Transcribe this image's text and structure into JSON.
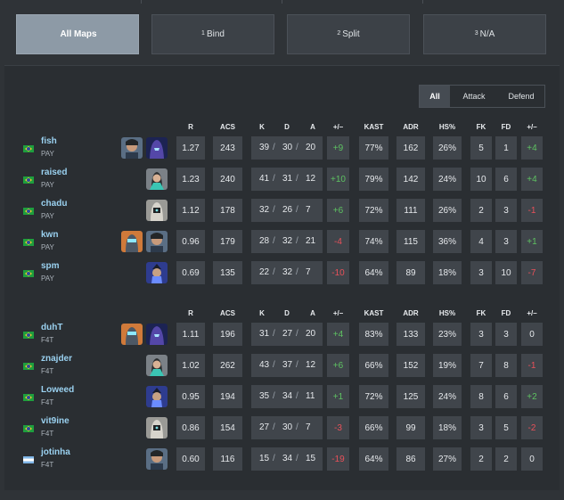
{
  "tabs": [
    {
      "num": "",
      "label": "All Maps",
      "active": true
    },
    {
      "num": "1",
      "label": "Bind",
      "active": false
    },
    {
      "num": "2",
      "label": "Split",
      "active": false
    },
    {
      "num": "3",
      "label": "N/A",
      "active": false
    }
  ],
  "filter": {
    "all": "All",
    "attack": "Attack",
    "defend": "Defend"
  },
  "columns": [
    "R",
    "ACS",
    "K",
    "D",
    "A",
    "+/–",
    "KAST",
    "ADR",
    "HS%",
    "FK",
    "FD",
    "+/–"
  ],
  "kda_separator": "/",
  "colors": {
    "positive": "#5ec262",
    "negative": "#e8515a",
    "accent_name": "#9ad1f0"
  },
  "teams": [
    {
      "players": [
        {
          "name": "fish",
          "team": "PAY",
          "flag": "brazil-flag-icon",
          "agents": [
            "harbor-agent-icon",
            "omen-agent-icon"
          ],
          "r": "1.27",
          "acs": "243",
          "k": "39",
          "d": "30",
          "a": "20",
          "kd_diff": "+9",
          "kast": "77%",
          "adr": "162",
          "hs": "26%",
          "fk": "5",
          "fd": "1",
          "fk_diff": "+4"
        },
        {
          "name": "raised",
          "team": "PAY",
          "flag": "brazil-flag-icon",
          "agents": [
            "sage-agent-icon"
          ],
          "r": "1.23",
          "acs": "240",
          "k": "41",
          "d": "31",
          "a": "12",
          "kd_diff": "+10",
          "kast": "79%",
          "adr": "142",
          "hs": "24%",
          "fk": "10",
          "fd": "6",
          "fk_diff": "+4"
        },
        {
          "name": "chadu",
          "team": "PAY",
          "flag": "brazil-flag-icon",
          "agents": [
            "cypher-agent-icon"
          ],
          "r": "1.12",
          "acs": "178",
          "k": "32",
          "d": "26",
          "a": "7",
          "kd_diff": "+6",
          "kast": "72%",
          "adr": "111",
          "hs": "26%",
          "fk": "2",
          "fd": "3",
          "fk_diff": "-1"
        },
        {
          "name": "kwn",
          "team": "PAY",
          "flag": "brazil-flag-icon",
          "agents": [
            "kayo-agent-icon",
            "harbor-agent-icon"
          ],
          "r": "0.96",
          "acs": "179",
          "k": "28",
          "d": "32",
          "a": "21",
          "kd_diff": "-4",
          "kast": "74%",
          "adr": "115",
          "hs": "36%",
          "fk": "4",
          "fd": "3",
          "fk_diff": "+1"
        },
        {
          "name": "spm",
          "team": "PAY",
          "flag": "brazil-flag-icon",
          "agents": [
            "yoru-agent-icon"
          ],
          "r": "0.69",
          "acs": "135",
          "k": "22",
          "d": "32",
          "a": "7",
          "kd_diff": "-10",
          "kast": "64%",
          "adr": "89",
          "hs": "18%",
          "fk": "3",
          "fd": "10",
          "fk_diff": "-7"
        }
      ]
    },
    {
      "players": [
        {
          "name": "duhT",
          "team": "F4T",
          "flag": "brazil-flag-icon",
          "agents": [
            "kayo-agent-icon",
            "omen-agent-icon"
          ],
          "r": "1.11",
          "acs": "196",
          "k": "31",
          "d": "27",
          "a": "20",
          "kd_diff": "+4",
          "kast": "83%",
          "adr": "133",
          "hs": "23%",
          "fk": "3",
          "fd": "3",
          "fk_diff": "0"
        },
        {
          "name": "znajder",
          "team": "F4T",
          "flag": "brazil-flag-icon",
          "agents": [
            "sage-agent-icon"
          ],
          "r": "1.02",
          "acs": "262",
          "k": "43",
          "d": "37",
          "a": "12",
          "kd_diff": "+6",
          "kast": "66%",
          "adr": "152",
          "hs": "19%",
          "fk": "7",
          "fd": "8",
          "fk_diff": "-1"
        },
        {
          "name": "Loweed",
          "team": "F4T",
          "flag": "brazil-flag-icon",
          "agents": [
            "yoru-agent-icon"
          ],
          "r": "0.95",
          "acs": "194",
          "k": "35",
          "d": "34",
          "a": "11",
          "kd_diff": "+1",
          "kast": "72%",
          "adr": "125",
          "hs": "24%",
          "fk": "8",
          "fd": "6",
          "fk_diff": "+2"
        },
        {
          "name": "vit9ine",
          "team": "F4T",
          "flag": "brazil-flag-icon",
          "agents": [
            "cypher-agent-icon"
          ],
          "r": "0.86",
          "acs": "154",
          "k": "27",
          "d": "30",
          "a": "7",
          "kd_diff": "-3",
          "kast": "66%",
          "adr": "99",
          "hs": "18%",
          "fk": "3",
          "fd": "5",
          "fk_diff": "-2"
        },
        {
          "name": "jotinha",
          "team": "F4T",
          "flag": "argentina-flag-icon",
          "agents": [
            "harbor-agent-icon"
          ],
          "r": "0.60",
          "acs": "116",
          "k": "15",
          "d": "34",
          "a": "15",
          "kd_diff": "-19",
          "kast": "64%",
          "adr": "86",
          "hs": "27%",
          "fk": "2",
          "fd": "2",
          "fk_diff": "0"
        }
      ]
    }
  ]
}
